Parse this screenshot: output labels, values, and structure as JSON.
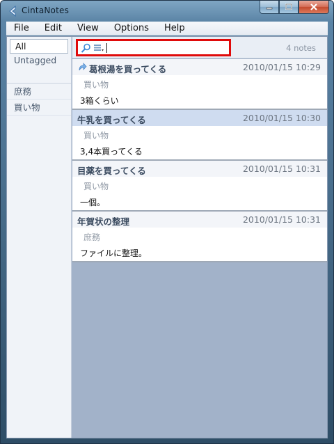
{
  "window": {
    "title": "CintaNotes"
  },
  "menu": {
    "items": [
      {
        "label": "File"
      },
      {
        "label": "Edit"
      },
      {
        "label": "View"
      },
      {
        "label": "Options"
      },
      {
        "label": "Help"
      }
    ]
  },
  "sidebar": {
    "items": [
      {
        "label": "All"
      },
      {
        "label": "Untagged"
      },
      {
        "label": "庶務"
      },
      {
        "label": "買い物"
      }
    ]
  },
  "search": {
    "value": "",
    "note_count": "4 notes",
    "highlight_color": "#e00b0b"
  },
  "notes": [
    {
      "title": "葛根湯を買ってくる",
      "date": "2010/01/15 10:29",
      "tag": "買い物",
      "body": "3箱くらい"
    },
    {
      "title": "牛乳を買ってくる",
      "date": "2010/01/15 10:30",
      "tag": "買い物",
      "body": "3,4本買ってくる"
    },
    {
      "title": "目薬を買ってくる",
      "date": "2010/01/15 10:31",
      "tag": "買い物",
      "body": "一個。"
    },
    {
      "title": "年賀状の整理",
      "date": "2010/01/15 10:31",
      "tag": "庶務",
      "body": "ファイルに整理。"
    }
  ]
}
